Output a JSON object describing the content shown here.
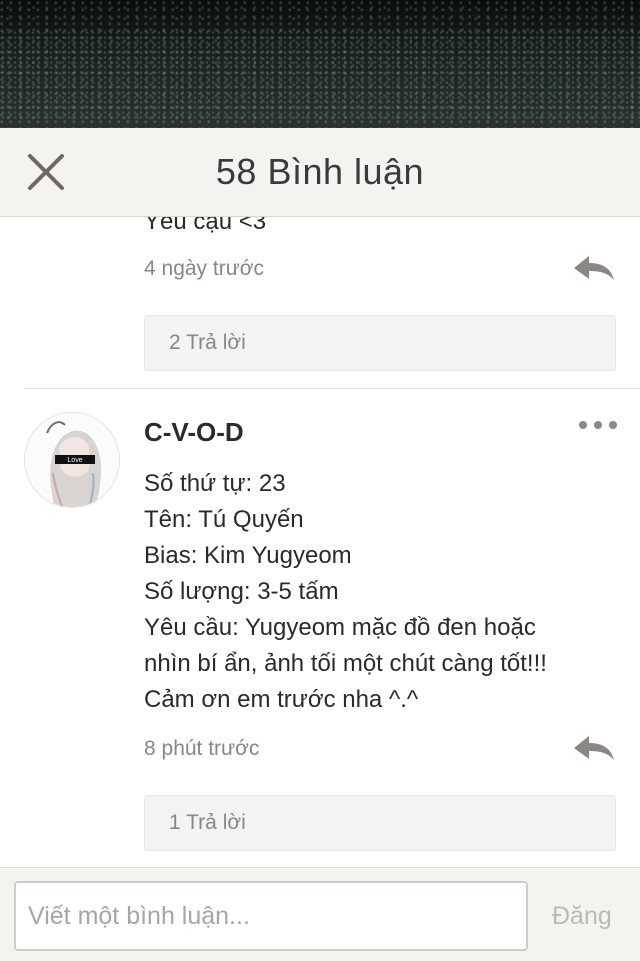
{
  "header": {
    "title": "58 Bình luận"
  },
  "comments": [
    {
      "partial_text": "Yêu cậu <3",
      "time": "4 ngày trước",
      "replies_label": "2 Trả lời"
    },
    {
      "username": "C-V-O-D",
      "avatar_badge": "Love",
      "lines": [
        "Số thứ tự: 23",
        "Tên: Tú Quyến",
        "Bias: Kim Yugyeom",
        "Số lượng: 3-5 tấm",
        "Yêu cầu: Yugyeom mặc đồ đen hoặc",
        "nhìn bí ẩn, ảnh tối một chút càng tốt!!!",
        "Cảm ơn em trước nha ^.^"
      ],
      "time": "8 phút trước",
      "replies_label": "1 Trả lời"
    }
  ],
  "footer": {
    "input_placeholder": "Viết một bình luận...",
    "post_label": "Đăng"
  },
  "colors": {
    "header_bg": "#f5f3ef",
    "muted_text": "#8a8783",
    "reply_icon": "#8c8782",
    "post_disabled": "#bdbab5"
  },
  "icons": [
    "close-icon",
    "reply-icon",
    "more-icon"
  ]
}
